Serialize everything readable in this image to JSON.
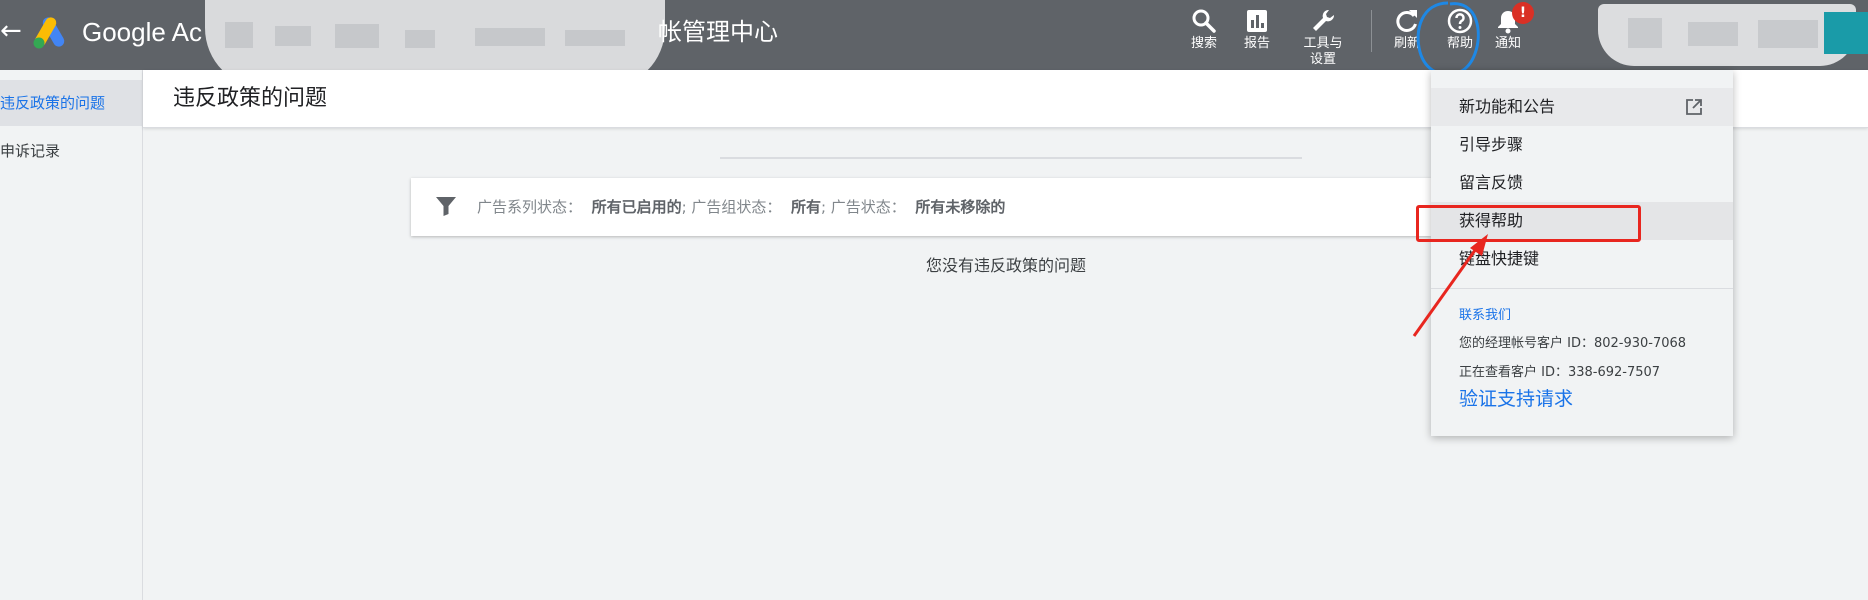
{
  "topbar": {
    "back_icon": "arrow-left-icon",
    "app_name": "Google Ac",
    "account_title": "帐管理中心",
    "tools": [
      {
        "label": "搜索",
        "icon": "search-icon"
      },
      {
        "label": "报告",
        "icon": "bar-chart-icon"
      },
      {
        "label": "工具与\n设置",
        "icon": "wrench-icon"
      },
      {
        "label": "刷新",
        "icon": "refresh-icon"
      },
      {
        "label": "帮助",
        "icon": "help-circle-icon"
      },
      {
        "label": "通知",
        "icon": "bell-icon"
      }
    ],
    "notification_badge": "!",
    "colors": {
      "bar": "#5f6368",
      "badge": "#d93025",
      "avatar_accent": "#1a9ba8"
    }
  },
  "sidebar": {
    "items": [
      {
        "label": "违反政策的问题",
        "active": true
      },
      {
        "label": "申诉记录",
        "active": false
      }
    ]
  },
  "main": {
    "title": "违反政策的问题",
    "filter": {
      "icon": "filter-icon",
      "parts": [
        {
          "label": "广告系列状态：",
          "value": "所有已启用的"
        },
        {
          "label": "; 广告组状态：",
          "value": "所有"
        },
        {
          "label": "; 广告状态：",
          "value": "所有未移除的"
        }
      ]
    },
    "empty_message": "您没有违反政策的问题"
  },
  "help_menu": {
    "items": [
      {
        "label": "新功能和公告",
        "icon": "external-link-icon"
      },
      {
        "label": "引导步骤"
      },
      {
        "label": "留言反馈"
      },
      {
        "label": "获得帮助"
      },
      {
        "label": "键盘快捷键"
      }
    ],
    "contact_title": "联系我们",
    "manager_id_line": "您的经理帐号客户 ID：802-930-7068",
    "viewing_id_line": "正在查看客户 ID：338-692-7507",
    "verify_link": "验证支持请求",
    "colors": {
      "link": "#1a73e8",
      "highlight_box": "#e8261f",
      "help_circle": "#1e88e5"
    }
  }
}
